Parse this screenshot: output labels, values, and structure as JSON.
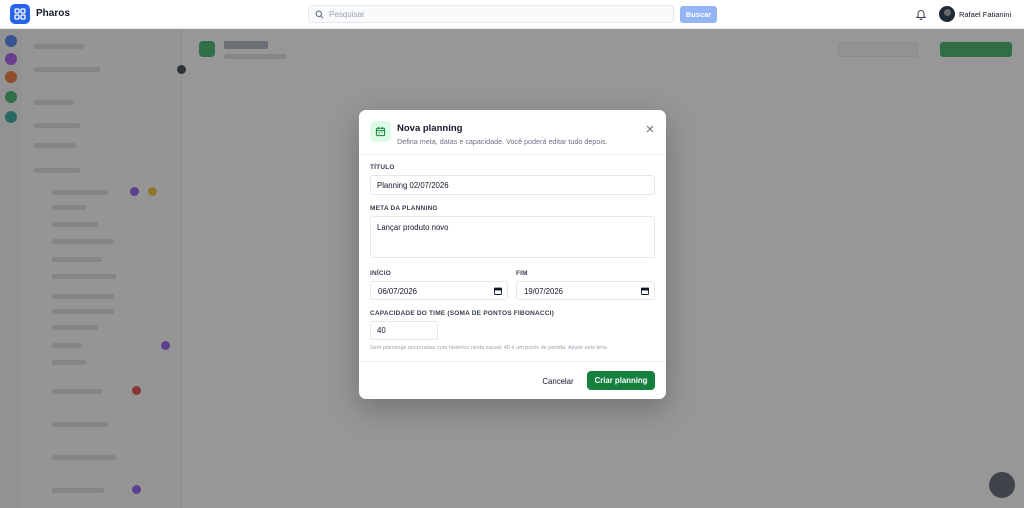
{
  "app": {
    "brand": "Pharos",
    "search_placeholder": "Pesquisar",
    "search_button": "Buscar",
    "user_name": "Rafael Fatianini"
  },
  "modal": {
    "title": "Nova planning",
    "description": "Defina meta, datas e capacidade. Você poderá editar tudo depois.",
    "fields": {
      "title_label": "TÍTULO",
      "title_value": "Planning 02/07/2026",
      "goal_label": "META DA PLANNING",
      "goal_value": "Lançar produto novo",
      "start_label": "INÍCIO",
      "start_value": "06/07/2026",
      "end_label": "FIM",
      "end_value": "19/07/2026",
      "capacity_label": "CAPACIDADE DO TIME (SOMA DE PONTOS FIBONACCI)",
      "capacity_value": "40",
      "capacity_hint": "Sem plannings encerradas com histórico nesta squad; 40 é um ponto de partida. Ajuste pelo time."
    },
    "cancel_label": "Cancelar",
    "submit_label": "Criar planning"
  },
  "colors": {
    "brand_blue": "#2563eb",
    "primary_green": "#15803d",
    "icon_bg_green": "#dcfce7"
  },
  "icons": {
    "logo": "grid-icon",
    "search": "search-icon",
    "bell": "bell-icon",
    "modal": "calendar-icon",
    "close": "close-icon",
    "date": "calendar-icon"
  }
}
